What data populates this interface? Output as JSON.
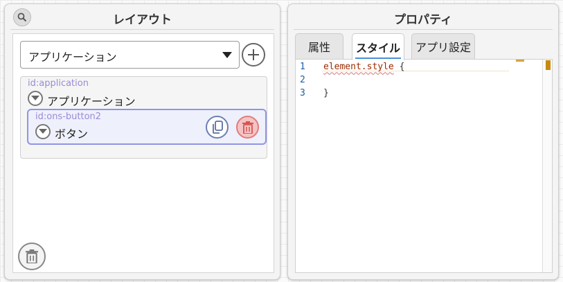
{
  "layout_panel": {
    "title": "レイアウト",
    "app_select": {
      "value": "アプリケーション"
    },
    "tree": {
      "root": {
        "id": "id:application",
        "label": "アプリケーション"
      },
      "child": {
        "id": "id:ons-button2",
        "label": "ボタン"
      }
    }
  },
  "property_panel": {
    "title": "プロパティ",
    "tabs": [
      {
        "label": "属性",
        "active": false
      },
      {
        "label": "スタイル",
        "active": true
      },
      {
        "label": "アプリ設定",
        "active": false
      }
    ],
    "editor": {
      "lines": [
        {
          "no": "1",
          "selector": "element.style",
          "rest": " {"
        },
        {
          "no": "2",
          "selector": "",
          "rest": ""
        },
        {
          "no": "3",
          "selector": "",
          "rest": "}"
        }
      ]
    }
  },
  "colors": {
    "accent_purple": "#8f95e5",
    "id_text": "#9b8ad6",
    "delete_red": "#e37b7b",
    "tab_underline": "#4a90d9",
    "line_number_blue": "#1a5fa6"
  },
  "icons": {
    "search": "search-icon",
    "add": "plus-icon",
    "collapse": "chevron-down-icon",
    "copy": "copy-icon",
    "delete": "trash-icon",
    "dropdown": "caret-down-icon"
  }
}
